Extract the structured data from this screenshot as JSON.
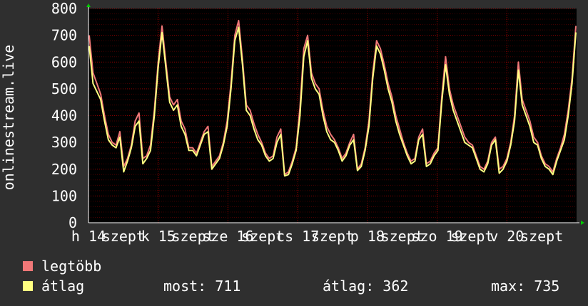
{
  "chart_data": {
    "type": "line",
    "ylabel": "onlinestream.live",
    "ylim": [
      0,
      800
    ],
    "yticks": [
      0,
      100,
      200,
      300,
      400,
      500,
      600,
      700,
      800
    ],
    "xtick_labels": [
      "h 14",
      "szept",
      "k 15",
      "szept",
      "sze 16",
      "szept",
      "cs 17",
      "szept",
      "p 18",
      "szept",
      "szo 19",
      "szept",
      "v 20",
      "szept"
    ],
    "grid": true,
    "legend_position": "bottom-left",
    "colors": {
      "max": "#f07878",
      "avg": "#ffff80",
      "plot_bg": "#000000",
      "page_bg": "#2f2f2f",
      "axis": "#ffffff",
      "grid": "#ff0000",
      "arrow": "#00cc00"
    },
    "series": [
      {
        "name": "legtöbb",
        "key": "max",
        "values": [
          700,
          560,
          520,
          480,
          400,
          330,
          300,
          290,
          340,
          210,
          240,
          290,
          380,
          410,
          240,
          250,
          290,
          420,
          600,
          735,
          600,
          470,
          440,
          460,
          380,
          350,
          280,
          280,
          260,
          300,
          340,
          360,
          210,
          230,
          250,
          300,
          380,
          520,
          700,
          755,
          610,
          440,
          420,
          370,
          330,
          300,
          260,
          240,
          250,
          320,
          350,
          180,
          190,
          230,
          280,
          430,
          650,
          700,
          560,
          520,
          500,
          420,
          360,
          330,
          310,
          280,
          240,
          260,
          300,
          330,
          200,
          220,
          280,
          380,
          560,
          680,
          650,
          590,
          520,
          470,
          400,
          350,
          300,
          260,
          230,
          240,
          320,
          350,
          220,
          230,
          260,
          280,
          470,
          620,
          500,
          440,
          400,
          360,
          320,
          300,
          290,
          250,
          210,
          200,
          230,
          300,
          320,
          200,
          210,
          240,
          300,
          400,
          600,
          460,
          420,
          380,
          320,
          300,
          250,
          220,
          210,
          190,
          240,
          280,
          330,
          420,
          540,
          735
        ]
      },
      {
        "name": "átlag",
        "key": "avg",
        "values": [
          660,
          520,
          490,
          460,
          380,
          310,
          290,
          280,
          320,
          190,
          230,
          280,
          360,
          380,
          220,
          240,
          270,
          400,
          580,
          710,
          580,
          450,
          420,
          440,
          360,
          330,
          270,
          270,
          250,
          290,
          330,
          340,
          200,
          220,
          240,
          290,
          360,
          500,
          680,
          730,
          590,
          420,
          400,
          350,
          310,
          290,
          250,
          230,
          240,
          300,
          330,
          175,
          180,
          220,
          270,
          400,
          620,
          680,
          540,
          500,
          480,
          400,
          340,
          310,
          300,
          270,
          230,
          250,
          290,
          310,
          195,
          210,
          270,
          360,
          540,
          660,
          630,
          570,
          500,
          450,
          380,
          330,
          290,
          250,
          220,
          230,
          310,
          330,
          210,
          220,
          250,
          270,
          450,
          590,
          480,
          420,
          380,
          340,
          300,
          290,
          280,
          240,
          200,
          190,
          220,
          290,
          310,
          185,
          200,
          230,
          290,
          380,
          570,
          440,
          400,
          360,
          300,
          290,
          240,
          210,
          200,
          180,
          230,
          270,
          310,
          400,
          520,
          711
        ]
      }
    ]
  },
  "legend": {
    "max_label": "legtöbb",
    "avg_label": "átlag",
    "most": "most: 711",
    "avg": "átlag: 362",
    "max": "max: 735"
  }
}
